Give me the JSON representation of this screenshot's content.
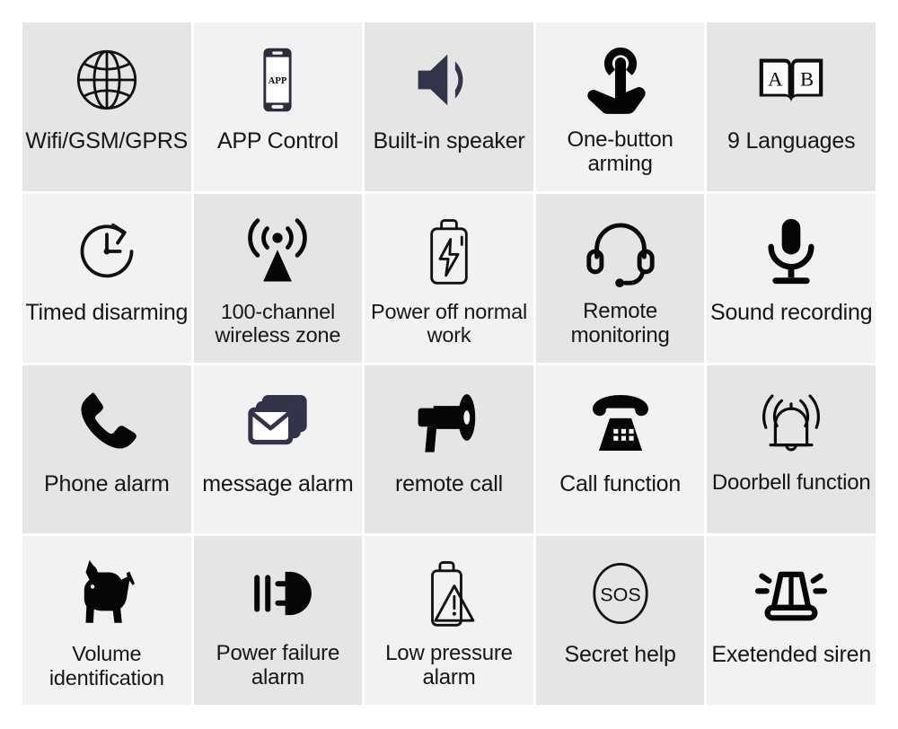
{
  "grid": {
    "columns": 5,
    "rows": 4,
    "background": "#ffffff",
    "cell_shade_dark": "#e5e5e5",
    "cell_shade_light": "#f2f2f2",
    "text_color": "#161616"
  },
  "cells": [
    {
      "label": "Wifi/GSM/GPRS",
      "icon": "globe-icon",
      "shade": "dark"
    },
    {
      "label": "APP Control",
      "icon": "smartphone-app-icon",
      "shade": "light"
    },
    {
      "label": "Built-in speaker",
      "icon": "speaker-icon",
      "shade": "dark"
    },
    {
      "label": "One-button arming",
      "icon": "hand-press-button-icon",
      "shade": "light"
    },
    {
      "label": "9 Languages",
      "icon": "open-book-ab-icon",
      "shade": "dark"
    },
    {
      "label": "Timed disarming",
      "icon": "clock-arrow-icon",
      "shade": "light"
    },
    {
      "label": "100-channel wireless zone",
      "icon": "antenna-signal-icon",
      "shade": "dark"
    },
    {
      "label": "Power off normal work",
      "icon": "battery-bolt-icon",
      "shade": "light"
    },
    {
      "label": "Remote monitoring",
      "icon": "headset-icon",
      "shade": "dark"
    },
    {
      "label": "Sound recording",
      "icon": "microphone-icon",
      "shade": "light"
    },
    {
      "label": "Phone alarm",
      "icon": "phone-handset-icon",
      "shade": "dark"
    },
    {
      "label": "message alarm",
      "icon": "envelope-stack-icon",
      "shade": "light"
    },
    {
      "label": "remote call",
      "icon": "megaphone-icon",
      "shade": "dark"
    },
    {
      "label": "Call function",
      "icon": "telephone-icon",
      "shade": "light"
    },
    {
      "label": "Doorbell function",
      "icon": "ringing-bell-icon",
      "shade": "dark"
    },
    {
      "label": "Volume identification",
      "icon": "dog-icon",
      "shade": "light"
    },
    {
      "label": "Power failure alarm",
      "icon": "power-plug-icon",
      "shade": "dark"
    },
    {
      "label": "Low pressure alarm",
      "icon": "battery-warning-icon",
      "shade": "light"
    },
    {
      "label": "Secret help",
      "icon": "sos-circle-icon",
      "shade": "dark"
    },
    {
      "label": "Exetended siren",
      "icon": "siren-icon",
      "shade": "light"
    }
  ],
  "icon_text": {
    "app_screen": "APP",
    "book_left_letter": "A",
    "book_right_letter": "B",
    "sos": "SOS"
  }
}
